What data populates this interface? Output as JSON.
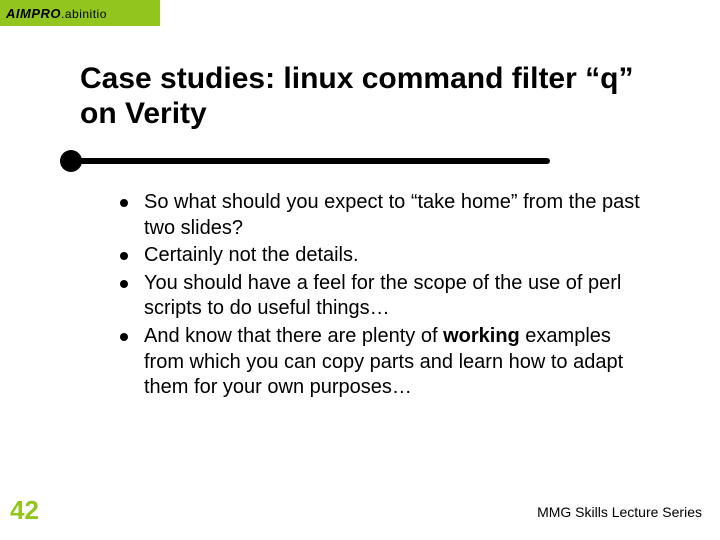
{
  "logo": {
    "brand_aim": "AIM",
    "brand_pro": "PRO",
    "brand_dot": ".",
    "brand_sub": "abinitio"
  },
  "title": "Case studies: linux command filter “q” on Verity",
  "bullets": [
    "So what should you expect to “take home” from the past two slides?",
    "Certainly not the details.",
    "You should have a feel for the scope of the use of perl scripts to do useful things…",
    "And know that there are plenty of <strong>working</strong> examples from which you can copy parts and learn how to adapt them for your own purposes…"
  ],
  "page_number": "42",
  "footer": "MMG Skills Lecture Series"
}
